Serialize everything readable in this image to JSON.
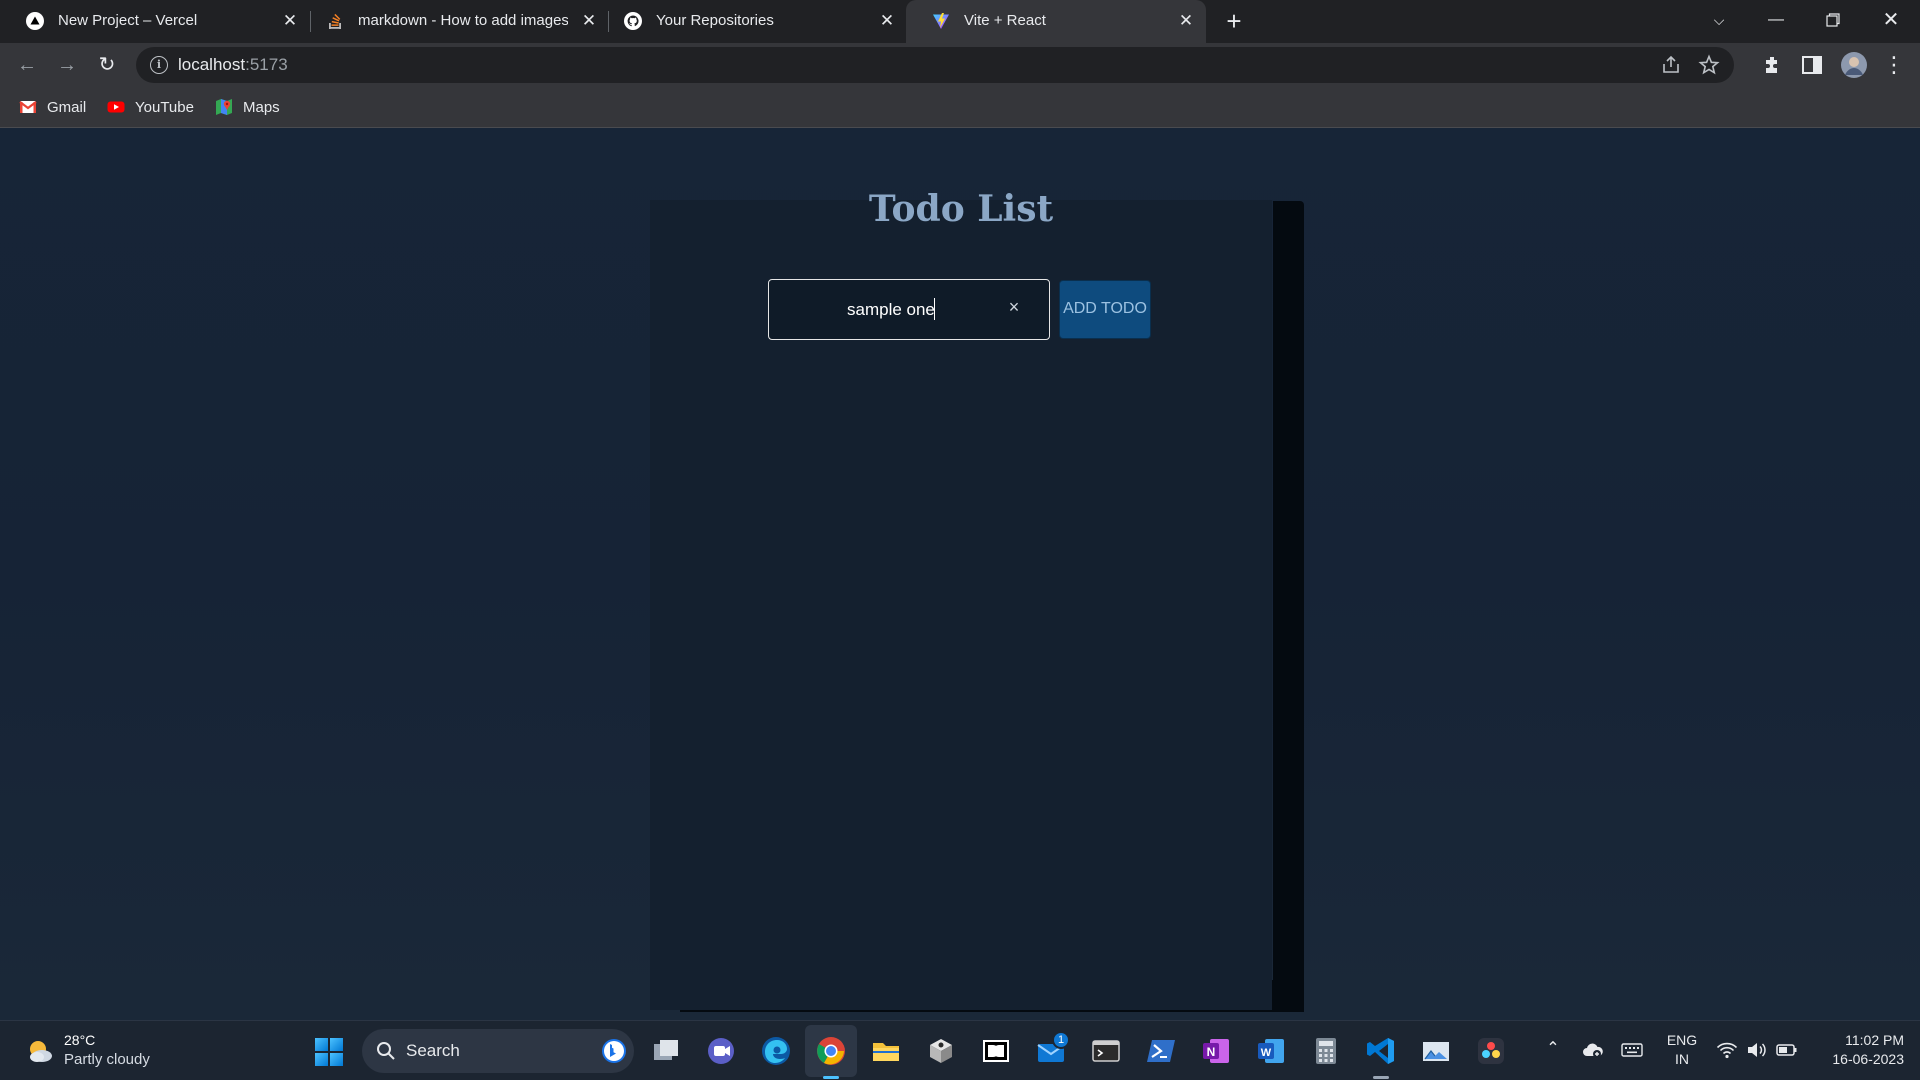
{
  "browser": {
    "tabs": [
      {
        "title": "New Project – Vercel",
        "icon": "vercel-icon"
      },
      {
        "title": "markdown - How to add images",
        "icon": "stackoverflow-icon"
      },
      {
        "title": "Your Repositories",
        "icon": "github-icon"
      },
      {
        "title": "Vite + React",
        "icon": "vite-icon",
        "active": true
      }
    ],
    "url_host": "localhost",
    "url_port": ":5173",
    "bookmarks": [
      {
        "label": "Gmail",
        "icon": "gmail-icon"
      },
      {
        "label": "YouTube",
        "icon": "youtube-icon"
      },
      {
        "label": "Maps",
        "icon": "maps-icon"
      }
    ]
  },
  "app": {
    "title": "Todo List",
    "input_value": "sample one",
    "clear_symbol": "×",
    "add_button_label": "ADD TODO",
    "colors": {
      "title": "#8ba7c6",
      "button": "#0e4b7e",
      "panel": "#14202f"
    }
  },
  "taskbar": {
    "weather_temp": "28°C",
    "weather_condition": "Partly cloudy",
    "search_label": "Search",
    "mail_badge": "1",
    "lang_primary": "ENG",
    "lang_secondary": "IN",
    "time": "11:02 PM",
    "date": "16-06-2023"
  }
}
